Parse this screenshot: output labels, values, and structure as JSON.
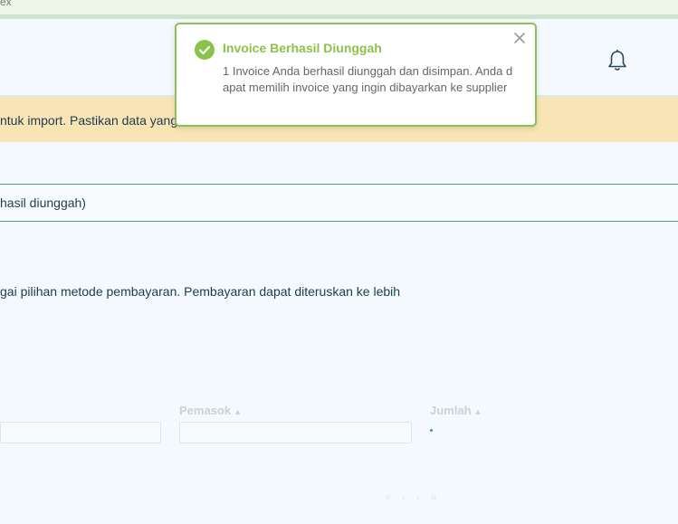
{
  "top_strip": {
    "fragment": "ex"
  },
  "warning": {
    "text": "ntuk import. Pastikan data yang"
  },
  "info_row": {
    "text": "hasil diunggah)"
  },
  "description": {
    "text": "gai pilihan metode pembayaran. Pembayaran dapat diteruskan ke lebih"
  },
  "table": {
    "columns": [
      {
        "label": "Pemasok",
        "sort_icon": "sort-icon"
      },
      {
        "label": "Jumlah",
        "sort_icon": "sort-icon"
      }
    ]
  },
  "pagination": {
    "first": "«",
    "prev": "‹",
    "next": "›",
    "last": "»"
  },
  "toast": {
    "title": "Invoice Berhasil Diunggah",
    "message": "1 Invoice Anda berhasil diunggah dan disimpan. Anda dapat memilih invoice yang ingin dibayarkan ke supplier",
    "icon": "check-circle-icon",
    "accent_color": "#8bc34a"
  },
  "header": {
    "icon": "bell-icon"
  }
}
